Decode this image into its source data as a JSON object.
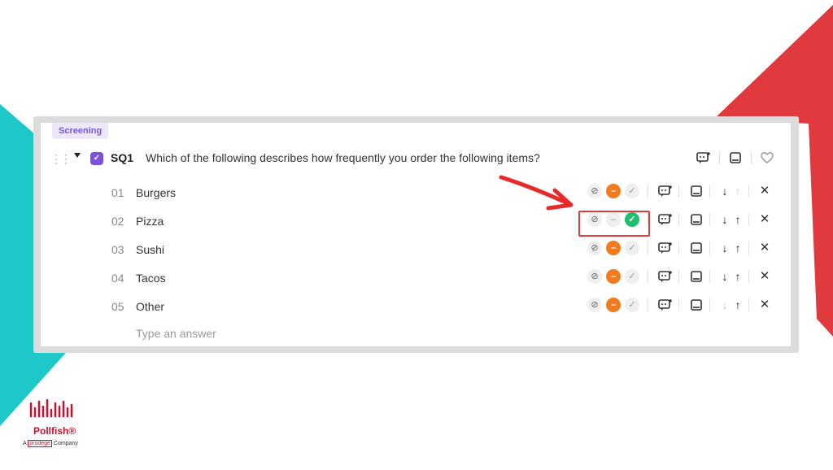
{
  "question": {
    "tag": "Screening",
    "id": "SQ1",
    "text": "Which of the following describes how frequently you order the following items?"
  },
  "answers": [
    {
      "num": "01",
      "text": "Burgers",
      "state": "minus",
      "up_enabled": false,
      "down_enabled": true
    },
    {
      "num": "02",
      "text": "Pizza",
      "state": "check",
      "up_enabled": true,
      "down_enabled": true
    },
    {
      "num": "03",
      "text": "Sushi",
      "state": "minus",
      "up_enabled": true,
      "down_enabled": true
    },
    {
      "num": "04",
      "text": "Tacos",
      "state": "minus",
      "up_enabled": true,
      "down_enabled": true
    },
    {
      "num": "05",
      "text": "Other",
      "state": "minus",
      "up_enabled": true,
      "down_enabled": false
    }
  ],
  "new_answer_placeholder": "Type an answer",
  "logo": {
    "word": "Pollfish®",
    "sub_prefix": "A ",
    "sub_brand": "prodege",
    "sub_suffix": " Company"
  },
  "icons": {
    "null_icon": "⊘",
    "minus_icon": "–",
    "check_icon": "✓",
    "close_icon": "✕",
    "arrow_down_icon": "↓",
    "arrow_up_icon": "↑"
  },
  "colors": {
    "accent_purple": "#7b4fe0",
    "orange": "#f37b1f",
    "green": "#1fbf6e",
    "red_brand": "#c8102e",
    "teal_deco": "#1ec8c8",
    "red_deco": "#e03a3e"
  }
}
